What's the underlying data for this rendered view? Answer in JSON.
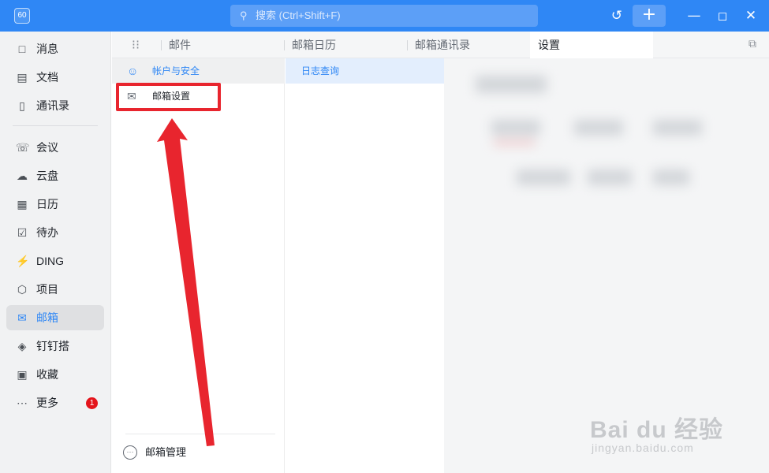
{
  "titlebar": {
    "logo_text": "60",
    "search_placeholder": "搜索 (Ctrl+Shift+F)",
    "search_icon": "search-icon",
    "plus_label": "+",
    "history_icon": "history-icon"
  },
  "colors": {
    "brand": "#2f87f5",
    "annotation": "#e8252e",
    "badge": "#e4151b"
  },
  "nav": {
    "items": [
      {
        "label": "消息",
        "icon": "message-icon"
      },
      {
        "label": "文档",
        "icon": "document-icon"
      },
      {
        "label": "通讯录",
        "icon": "contacts-icon"
      },
      {
        "label": "会议",
        "icon": "meeting-icon"
      },
      {
        "label": "云盘",
        "icon": "cloud-icon"
      },
      {
        "label": "日历",
        "icon": "calendar-icon"
      },
      {
        "label": "待办",
        "icon": "todo-icon"
      },
      {
        "label": "DING",
        "icon": "ding-icon"
      },
      {
        "label": "项目",
        "icon": "project-icon"
      },
      {
        "label": "邮箱",
        "icon": "mail-icon",
        "active": true
      },
      {
        "label": "钉钉搭",
        "icon": "builder-icon"
      },
      {
        "label": "收藏",
        "icon": "favorites-icon"
      },
      {
        "label": "更多",
        "icon": "more-icon",
        "badge": "1"
      }
    ]
  },
  "tabs": [
    {
      "label": "邮件"
    },
    {
      "label": "邮箱日历"
    },
    {
      "label": "邮箱通讯录"
    },
    {
      "label": "设置",
      "active": true
    }
  ],
  "settings": {
    "items": [
      {
        "label": "帐户与安全",
        "icon": "account-security-icon",
        "highlighted": true
      },
      {
        "label": "邮箱设置",
        "icon": "mail-settings-icon"
      }
    ],
    "footer_label": "邮箱管理"
  },
  "log": {
    "item_label": "日志查询"
  },
  "watermark": {
    "main": "Bai du 经验",
    "sub": "jingyan.baidu.com"
  }
}
